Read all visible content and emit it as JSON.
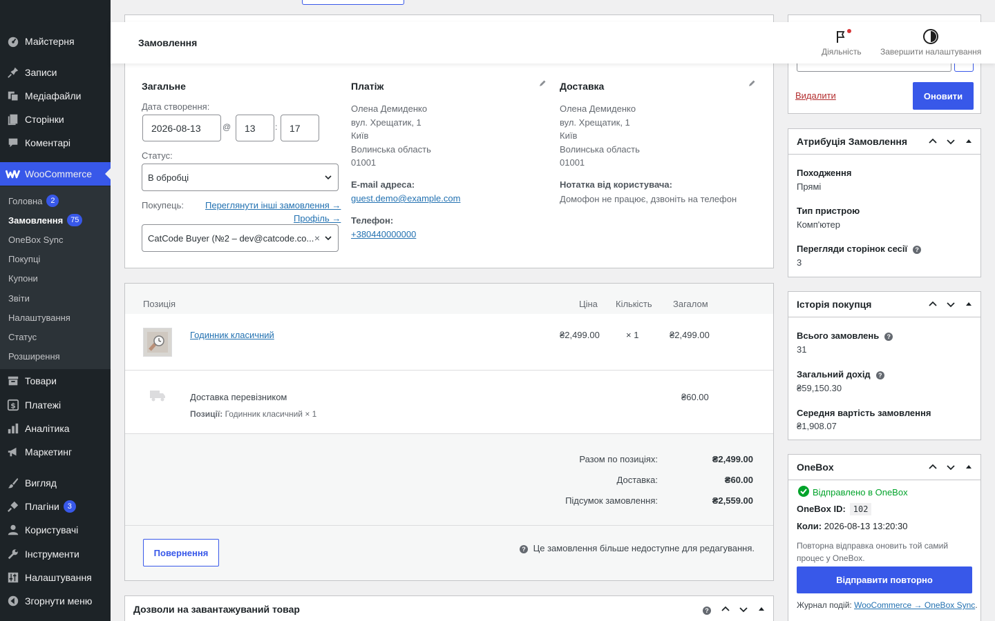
{
  "sidebar": {
    "items": [
      {
        "id": "dashboard",
        "label": "Майстерня",
        "icon": "dashboard-icon"
      },
      {
        "id": "posts",
        "label": "Записи",
        "icon": "pin-icon"
      },
      {
        "id": "media",
        "label": "Медіафайли",
        "icon": "media-icon"
      },
      {
        "id": "pages",
        "label": "Сторінки",
        "icon": "page-icon"
      },
      {
        "id": "comments",
        "label": "Коментарі",
        "icon": "comment-icon"
      },
      {
        "id": "woocommerce",
        "label": "WooCommerce",
        "icon": "woocommerce-icon"
      },
      {
        "id": "products",
        "label": "Товари",
        "icon": "archive-icon"
      },
      {
        "id": "payments",
        "label": "Платежі",
        "icon": "dollar-icon"
      },
      {
        "id": "analytics",
        "label": "Аналітика",
        "icon": "chart-bar-icon"
      },
      {
        "id": "marketing",
        "label": "Маркетинг",
        "icon": "megaphone-icon"
      },
      {
        "id": "appearance",
        "label": "Вигляд",
        "icon": "brush-icon"
      },
      {
        "id": "plugins",
        "label": "Плагіни",
        "icon": "plugin-icon",
        "badge": "3"
      },
      {
        "id": "users",
        "label": "Користувачі",
        "icon": "user-icon"
      },
      {
        "id": "tools",
        "label": "Інструменти",
        "icon": "wrench-icon"
      },
      {
        "id": "settings",
        "label": "Налаштування",
        "icon": "sliders-icon"
      },
      {
        "id": "collapse",
        "label": "Згорнути меню",
        "icon": "collapse-icon"
      }
    ],
    "submenu": [
      {
        "label": "Головна",
        "badge": "2"
      },
      {
        "label": "Замовлення",
        "badge": "75"
      },
      {
        "label": "OneBox Sync"
      },
      {
        "label": "Покупці"
      },
      {
        "label": "Купони"
      },
      {
        "label": "Звіти"
      },
      {
        "label": "Налаштування"
      },
      {
        "label": "Статус"
      },
      {
        "label": "Розширення"
      }
    ]
  },
  "header": {
    "title": "Замовлення",
    "activity_label": "Діяльність",
    "finish_setup_label": "Завершити налаштування"
  },
  "general": {
    "title": "Загальне",
    "date_label": "Дата створення:",
    "date": "2026-08-13",
    "at": "@",
    "hour": "13",
    "colon": ":",
    "minute": "17",
    "status_label": "Статус:",
    "status": "В обробці",
    "customer_label": "Покупець:",
    "view_orders_link": "Переглянути інші замовлення →",
    "profile_link": "Профіль →",
    "customer": "CatCode Buyer (№2 – dev@catcode.co...",
    "clear": "×"
  },
  "billing": {
    "title": "Платіж",
    "address": [
      "Олена Демиденко",
      "вул. Хрещатик, 1",
      "Київ",
      "Волинська область",
      "01001"
    ],
    "email_label": "E-mail адреса:",
    "email": "guest.demo@example.com",
    "phone_label": "Телефон:",
    "phone": "+380440000000"
  },
  "shipping": {
    "title": "Доставка",
    "address": [
      "Олена Демиденко",
      "вул. Хрещатик, 1",
      "Київ",
      "Волинська область",
      "01001"
    ],
    "note_label": "Нотатка від користувача:",
    "note": "Домофон не працює, дзвоніть на телефон"
  },
  "items": {
    "headers": {
      "item": "Позиція",
      "cost": "Ціна",
      "qty": "Кількість",
      "total": "Загалом"
    },
    "product": {
      "name": "Годинник класичний",
      "cost": "₴2,499.00",
      "qty": "× 1",
      "total": "₴2,499.00"
    },
    "shipping_line": {
      "name": "Доставка перевізником",
      "items_label": "Позиції:",
      "items": "Годинник класичний × 1",
      "total": "₴60.00"
    },
    "totals": [
      {
        "label": "Разом по позиціях:",
        "value": "₴2,499.00"
      },
      {
        "label": "Доставка:",
        "value": "₴60.00"
      },
      {
        "label": "Підсумок замовлення:",
        "value": "₴2,559.00"
      }
    ],
    "refund_button": "Повернення",
    "not_editable": "Це замовлення більше недоступне для редагування."
  },
  "downloads": {
    "title": "Дозволи на завантажуваний товар"
  },
  "actions": {
    "delete_link": "Видалити",
    "update_button": "Оновити"
  },
  "attribution": {
    "title": "Атрибуція Замовлення",
    "origin_label": "Походження",
    "origin": "Прямі",
    "device_label": "Тип пристрою",
    "device": "Комп'ютер",
    "pageviews_label": "Перегляди сторінок сесії",
    "pageviews": "3"
  },
  "history": {
    "title": "Історія покупця",
    "total_orders_label": "Всього замовлень",
    "total_orders": "31",
    "revenue_label": "Загальний дохід",
    "revenue": "₴59,150.30",
    "aov_label": "Середня вартість замовлення",
    "aov": "₴1,908.07"
  },
  "onebox": {
    "title": "OneBox",
    "status": "Відправлено в OneBox",
    "id_label": "OneBox ID:",
    "id": "102",
    "when_label": "Коли:",
    "when": "2026-08-13 13:20:30",
    "hint": "Повторна відправка оновить той самий процес у OneBox.",
    "resend_button": "Відправити повторно",
    "log_label": "Журнал подій:",
    "log_link": "WooCommerce → OneBox Sync",
    "log_end": "."
  },
  "colors": {
    "accent": "#3858e9",
    "sidebar": "#1d2327",
    "success": "#00a32a"
  }
}
